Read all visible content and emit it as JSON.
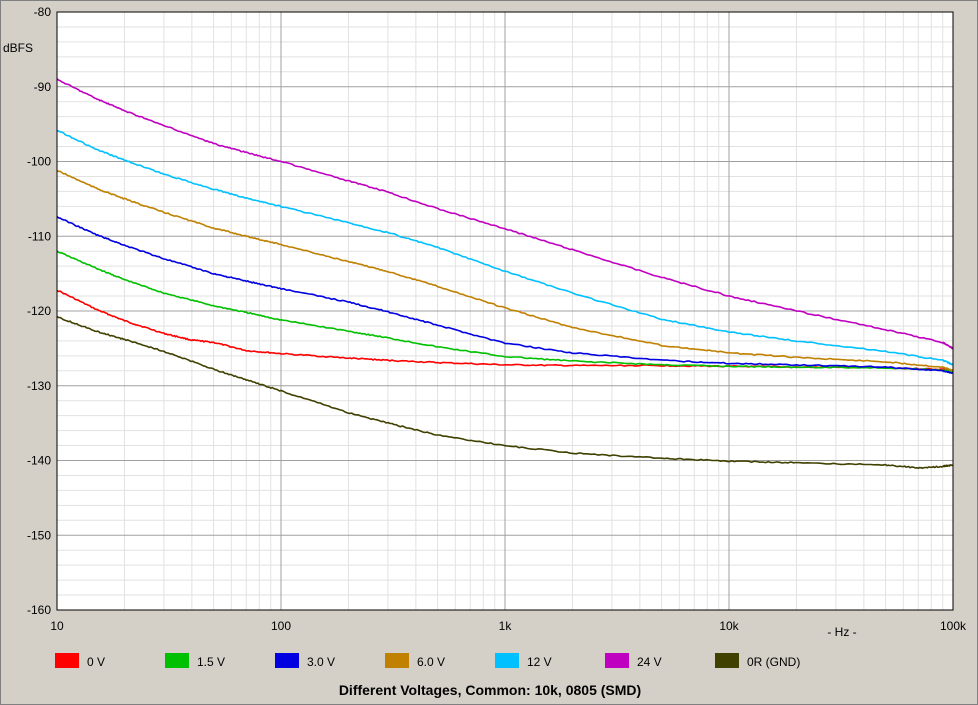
{
  "chart_data": {
    "type": "line",
    "title": "Different Voltages, Common: 10k, 0805 (SMD)",
    "xlabel": "- Hz -",
    "ylabel": "dBFS",
    "x_scale": "log",
    "xlim": [
      10,
      100000
    ],
    "ylim": [
      -160,
      -80
    ],
    "x_tick_labels": [
      "10",
      "100",
      "1k",
      "10k",
      "100k"
    ],
    "x_ticks": [
      10,
      100,
      1000,
      10000,
      100000
    ],
    "y_ticks": [
      -80,
      -90,
      -100,
      -110,
      -120,
      -130,
      -140,
      -150,
      -160
    ],
    "grid": true,
    "legend_position": "bottom",
    "background_color": "#ffffff",
    "series": [
      {
        "name": "0 V",
        "color": "#ff0000",
        "x": [
          10,
          15,
          20,
          30,
          40,
          50,
          70,
          100,
          200,
          300,
          500,
          1000,
          2000,
          5000,
          10000,
          20000,
          50000,
          90000,
          100000
        ],
        "y": [
          -117.2,
          -119.8,
          -121.3,
          -123.0,
          -123.9,
          -124.2,
          -125.3,
          -125.7,
          -126.3,
          -126.6,
          -126.9,
          -127.2,
          -127.3,
          -127.3,
          -127.4,
          -127.5,
          -127.6,
          -127.8,
          -128.0
        ]
      },
      {
        "name": "1.5 V",
        "color": "#00c000",
        "x": [
          10,
          15,
          20,
          30,
          50,
          70,
          100,
          200,
          300,
          500,
          1000,
          2000,
          5000,
          10000,
          20000,
          50000,
          90000,
          100000
        ],
        "y": [
          -112.0,
          -114.3,
          -115.8,
          -117.6,
          -119.3,
          -120.2,
          -121.2,
          -122.7,
          -123.6,
          -124.8,
          -126.1,
          -126.7,
          -127.2,
          -127.4,
          -127.5,
          -127.6,
          -127.9,
          -128.1
        ]
      },
      {
        "name": "3.0 V",
        "color": "#0000e0",
        "x": [
          10,
          15,
          20,
          30,
          50,
          70,
          100,
          200,
          300,
          500,
          1000,
          2000,
          5000,
          10000,
          20000,
          50000,
          90000,
          100000
        ],
        "y": [
          -107.4,
          -109.8,
          -111.2,
          -113.0,
          -115.0,
          -116.0,
          -117.0,
          -118.8,
          -120.1,
          -121.9,
          -124.3,
          -125.6,
          -126.6,
          -127.0,
          -127.2,
          -127.5,
          -128.0,
          -128.3
        ]
      },
      {
        "name": "6.0 V",
        "color": "#c08000",
        "x": [
          10,
          15,
          20,
          30,
          50,
          70,
          100,
          200,
          300,
          500,
          1000,
          2000,
          5000,
          10000,
          20000,
          50000,
          90000,
          100000
        ],
        "y": [
          -101.2,
          -103.6,
          -105.0,
          -106.8,
          -108.9,
          -110.0,
          -111.1,
          -113.4,
          -114.7,
          -116.7,
          -119.6,
          -122.2,
          -124.6,
          -125.6,
          -126.2,
          -126.8,
          -127.5,
          -128.0
        ]
      },
      {
        "name": "12 V",
        "color": "#00c0ff",
        "x": [
          10,
          15,
          20,
          30,
          50,
          70,
          100,
          200,
          300,
          500,
          1000,
          2000,
          5000,
          10000,
          20000,
          50000,
          90000,
          100000
        ],
        "y": [
          -95.8,
          -98.4,
          -99.8,
          -101.7,
          -103.7,
          -104.9,
          -106.0,
          -108.2,
          -109.5,
          -111.5,
          -114.7,
          -117.6,
          -121.1,
          -122.8,
          -124.0,
          -125.4,
          -126.6,
          -127.2
        ]
      },
      {
        "name": "24 V",
        "color": "#c000c0",
        "x": [
          10,
          15,
          20,
          30,
          50,
          70,
          100,
          200,
          300,
          500,
          1000,
          2000,
          5000,
          10000,
          20000,
          50000,
          90000,
          100000
        ],
        "y": [
          -89.0,
          -91.6,
          -93.2,
          -95.2,
          -97.6,
          -98.8,
          -100.0,
          -102.6,
          -104.1,
          -106.3,
          -109.0,
          -111.8,
          -115.5,
          -118.0,
          -120.0,
          -122.5,
          -124.2,
          -125.0
        ]
      },
      {
        "name": "0R (GND)",
        "color": "#404000",
        "x": [
          10,
          15,
          20,
          30,
          50,
          70,
          100,
          200,
          300,
          500,
          1000,
          2000,
          5000,
          10000,
          20000,
          50000,
          70000,
          90000,
          100000
        ],
        "y": [
          -120.8,
          -122.7,
          -123.8,
          -125.4,
          -127.8,
          -129.2,
          -130.7,
          -133.6,
          -135.0,
          -136.6,
          -138.0,
          -139.0,
          -139.7,
          -140.1,
          -140.3,
          -140.6,
          -141.0,
          -140.8,
          -140.6
        ]
      }
    ]
  }
}
